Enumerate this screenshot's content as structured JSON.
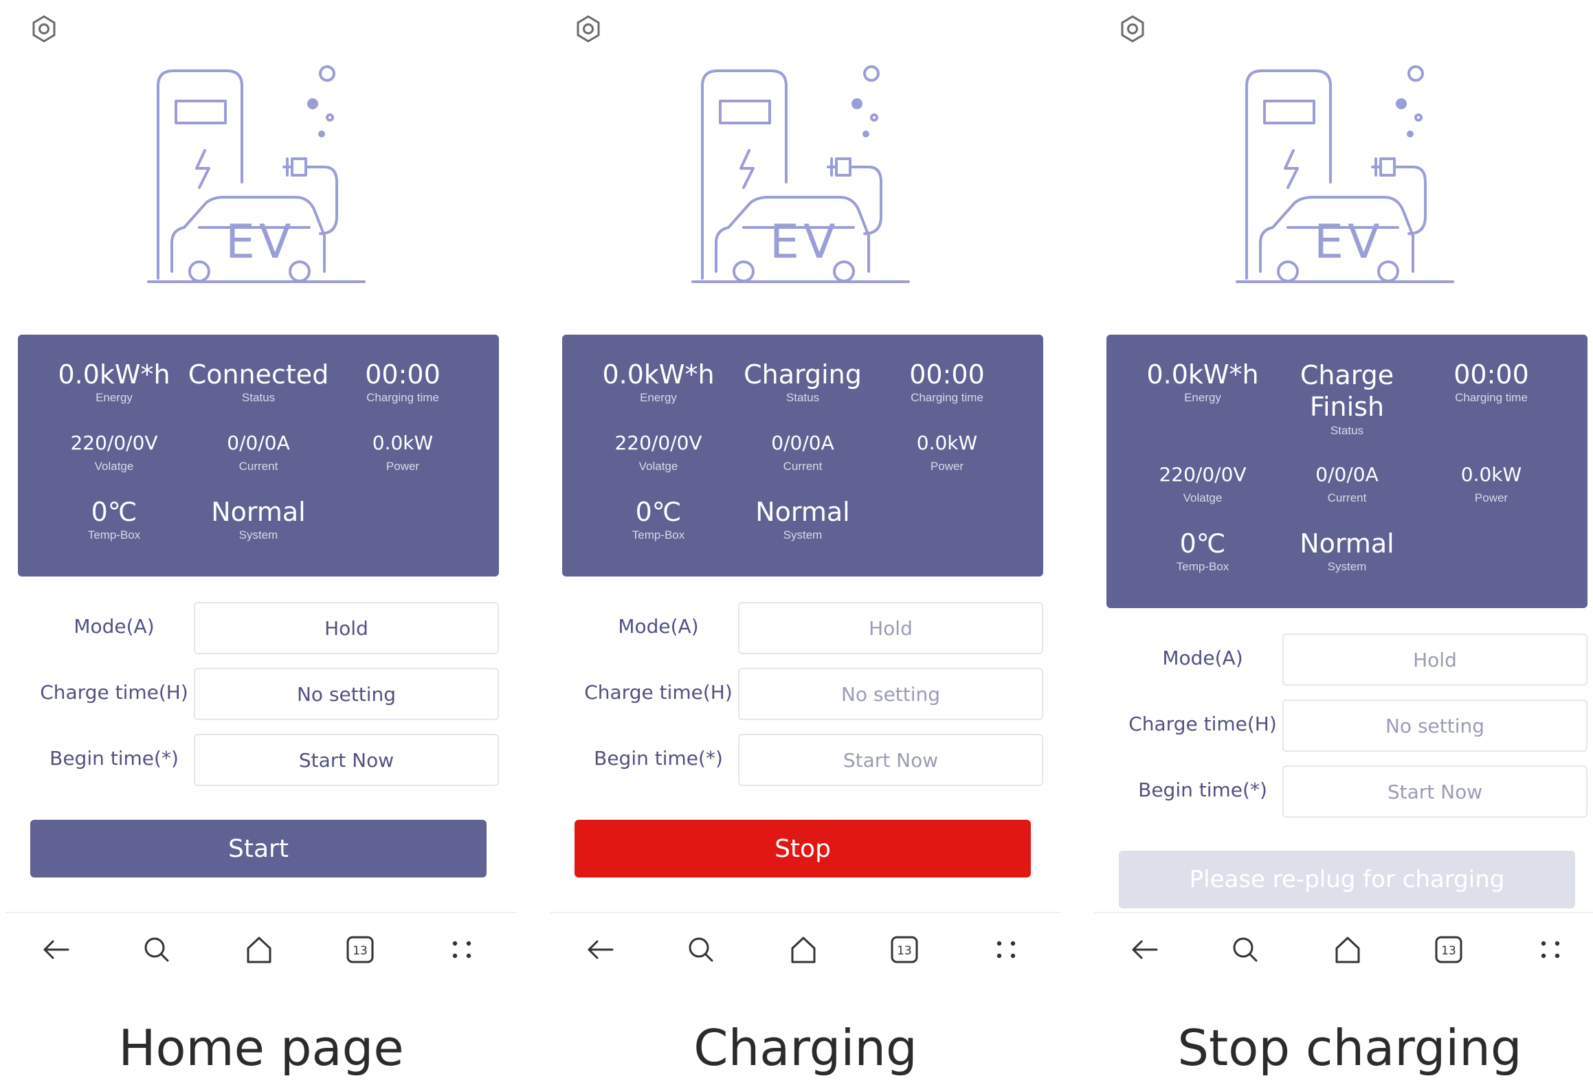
{
  "colors": {
    "card": "#5f6292",
    "illustration": "#9a9ed6",
    "start_button": "#5f6292",
    "stop_button": "#e01712",
    "replug_button": "#dde0ea"
  },
  "icons": {
    "settings": "settings-icon",
    "illustration": "ev-charging-station-icon",
    "nav": [
      "back-arrow-icon",
      "search-icon",
      "home-icon",
      "tabs-icon",
      "menu-dots-icon"
    ]
  },
  "nav": {
    "tabs_count": "13"
  },
  "field_labels": {
    "mode": "Mode(A)",
    "charge_time": "Charge time(H)",
    "begin_time": "Begin time(*)"
  },
  "metric_labels": {
    "energy": "Energy",
    "status": "Status",
    "charging_time": "Charging time",
    "voltage": "Volatge",
    "current": "Current",
    "power": "Power",
    "temp": "Temp-Box",
    "system": "System"
  },
  "panels": [
    {
      "energy": "0.0kW*h",
      "status_line1": "Connected",
      "status_line2": "",
      "charging_time": "00:00",
      "voltage": "220/0/0V",
      "current": "0/0/0A",
      "power": "0.0kW",
      "temp": "0℃",
      "system": "Normal",
      "mode_value": "Hold",
      "charge_time_value": "No setting",
      "begin_time_value": "Start Now",
      "action_label": "Start",
      "caption": "Home page"
    },
    {
      "energy": "0.0kW*h",
      "status_line1": "Charging",
      "status_line2": "",
      "charging_time": "00:00",
      "voltage": "220/0/0V",
      "current": "0/0/0A",
      "power": "0.0kW",
      "temp": "0℃",
      "system": "Normal",
      "mode_value": "Hold",
      "charge_time_value": "No setting",
      "begin_time_value": "Start Now",
      "action_label": "Stop",
      "caption": "Charging"
    },
    {
      "energy": "0.0kW*h",
      "status_line1": "Charge",
      "status_line2": "Finish",
      "charging_time": "00:00",
      "voltage": "220/0/0V",
      "current": "0/0/0A",
      "power": "0.0kW",
      "temp": "0℃",
      "system": "Normal",
      "mode_value": "Hold",
      "charge_time_value": "No setting",
      "begin_time_value": "Start Now",
      "action_label": "Please re-plug for charging",
      "caption": "Stop charging"
    }
  ]
}
